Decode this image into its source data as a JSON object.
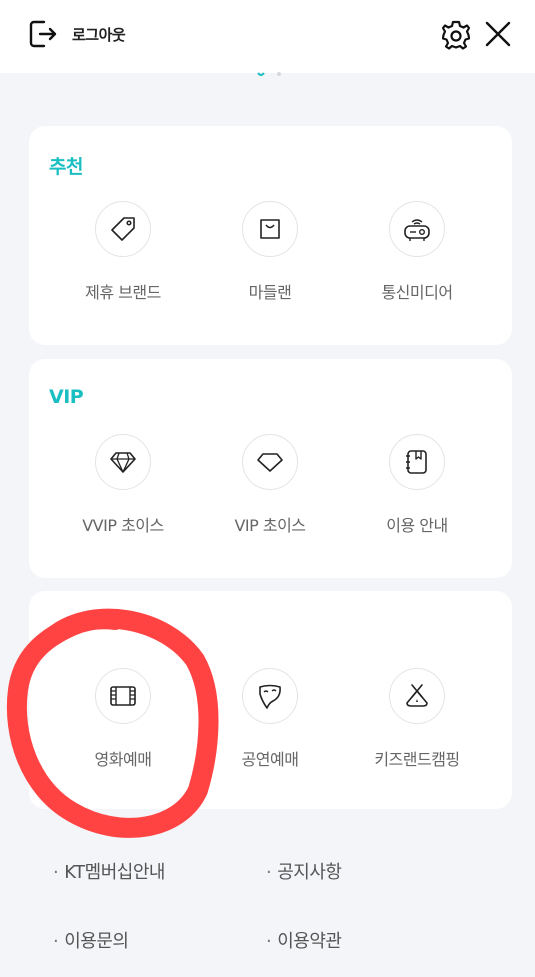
{
  "header": {
    "logout_label": "로그아웃",
    "icons": {
      "logout": "logout-icon",
      "settings": "gear-icon",
      "close": "close-icon"
    }
  },
  "sections": [
    {
      "title": "추천",
      "items": [
        {
          "label": "제휴 브랜드",
          "icon": "tag-icon"
        },
        {
          "label": "마들랜",
          "icon": "shopping-bag-icon"
        },
        {
          "label": "통신미디어",
          "icon": "router-icon"
        }
      ]
    },
    {
      "title": "VIP",
      "items": [
        {
          "label": "VVIP 초이스",
          "icon": "diamond-icon"
        },
        {
          "label": "VIP 초이스",
          "icon": "gem-icon"
        },
        {
          "label": "이용 안내",
          "icon": "notebook-icon"
        }
      ]
    },
    {
      "title": "",
      "items": [
        {
          "label": "영화예매",
          "icon": "film-icon"
        },
        {
          "label": "공연예매",
          "icon": "theater-mask-icon"
        },
        {
          "label": "키즈랜드캠핑",
          "icon": "tent-icon"
        }
      ]
    }
  ],
  "footer_links": [
    {
      "label": "KT멤버십안내"
    },
    {
      "label": "공지사항"
    },
    {
      "label": "이용문의"
    },
    {
      "label": "이용약관"
    }
  ],
  "footer_bullet": "·",
  "colors": {
    "accent": "#1bbfc2",
    "annotation": "#ff3b3b",
    "background": "#f4f5f9"
  }
}
